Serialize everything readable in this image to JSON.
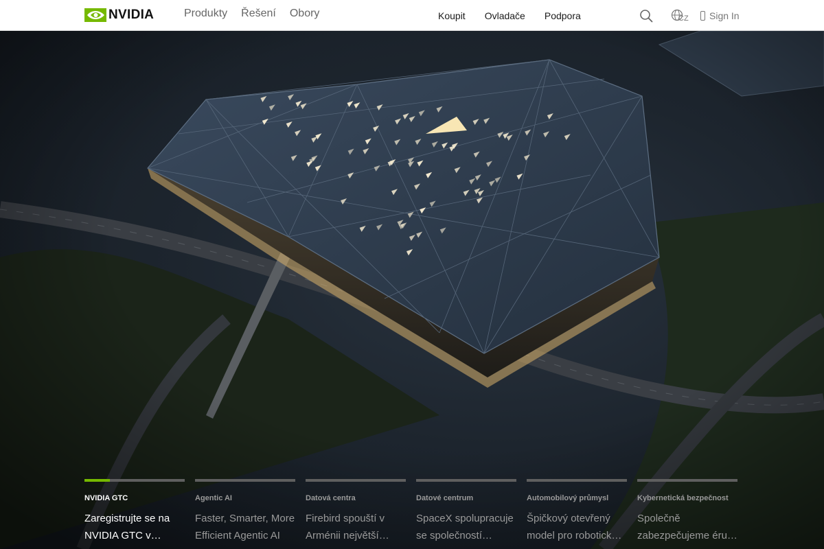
{
  "nav": {
    "brand": "NVIDIA",
    "primary": [
      "Produkty",
      "Řešení",
      "Obory"
    ],
    "secondary": [
      "Koupit",
      "Ovladače",
      "Podpora"
    ],
    "region": "CZ",
    "sign_in": "Sign In"
  },
  "colors": {
    "accent": "#76b900",
    "nav_bg": "#ffffff",
    "hero_bg": "#1d252e"
  },
  "icons": [
    "nvidia-eye-logo",
    "search-icon",
    "globe-icon",
    "user-icon"
  ],
  "carousel": {
    "active_index": 0,
    "active_progress_percent": 25,
    "items": [
      {
        "category": "NVIDIA GTC",
        "title_line1": "Zaregistrujte se na",
        "title_line2": "NVIDIA GTC v…"
      },
      {
        "category": "Agentic AI",
        "title_line1": "Faster, Smarter, More",
        "title_line2": "Efficient Agentic AI"
      },
      {
        "category": "Datová centra",
        "title_line1": "Firebird spouští v",
        "title_line2": "Arménii největší…"
      },
      {
        "category": "Datové centrum",
        "title_line1": "SpaceX spolupracuje",
        "title_line2": "se společností…"
      },
      {
        "category": "Automobilový průmysl",
        "title_line1": "Špičkový otevřený",
        "title_line2": "model pro robotick…"
      },
      {
        "category": "Kybernetická bezpečnost",
        "title_line1": "Společně",
        "title_line2": "zabezpečujeme éru…"
      }
    ]
  }
}
